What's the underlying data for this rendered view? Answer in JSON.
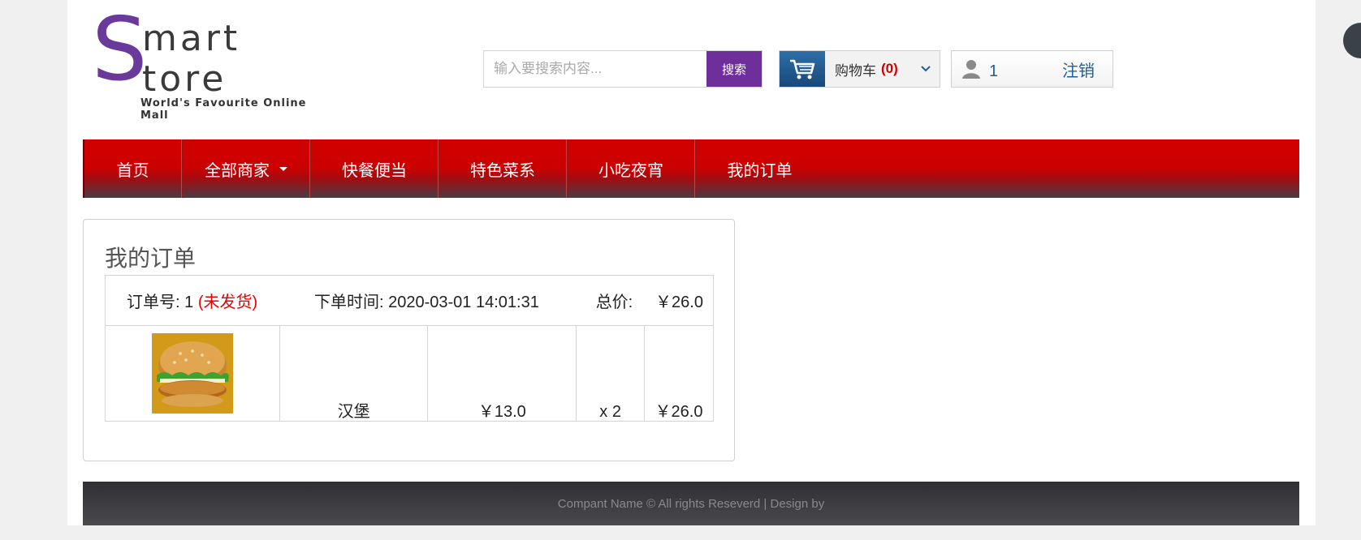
{
  "logo": {
    "initial": "S",
    "line1": "mart",
    "line2": "tore",
    "tagline": "World's Favourite Online Mall"
  },
  "search": {
    "placeholder": "输入要搜索内容...",
    "button_label": "搜索"
  },
  "cart": {
    "label": "购物车",
    "count": "(0)"
  },
  "user": {
    "name": "1",
    "logout_label": "注销"
  },
  "nav": {
    "items": [
      {
        "label": "首页"
      },
      {
        "label": "全部商家"
      },
      {
        "label": "快餐便当"
      },
      {
        "label": "特色菜系"
      },
      {
        "label": "小吃夜宵"
      },
      {
        "label": "我的订单"
      }
    ]
  },
  "orders": {
    "title": "我的订单",
    "order": {
      "number_label": "订单号: 1",
      "status": "(未发货)",
      "time_label": "下单时间: 2020-03-01 14:01:31",
      "total_label": "总价:",
      "total_value": "￥26.0",
      "item": {
        "image_icon": "hamburger-image",
        "name": "汉堡",
        "price": "￥13.0",
        "quantity": "x 2",
        "subtotal": "￥26.0"
      }
    }
  },
  "footer": {
    "text": "Compant Name © All rights Reseverd | Design by"
  },
  "colors": {
    "brand_purple": "#6e2f9a",
    "nav_red": "#cc0000",
    "link_blue": "#1d5f9b",
    "status_red": "#e00000"
  }
}
